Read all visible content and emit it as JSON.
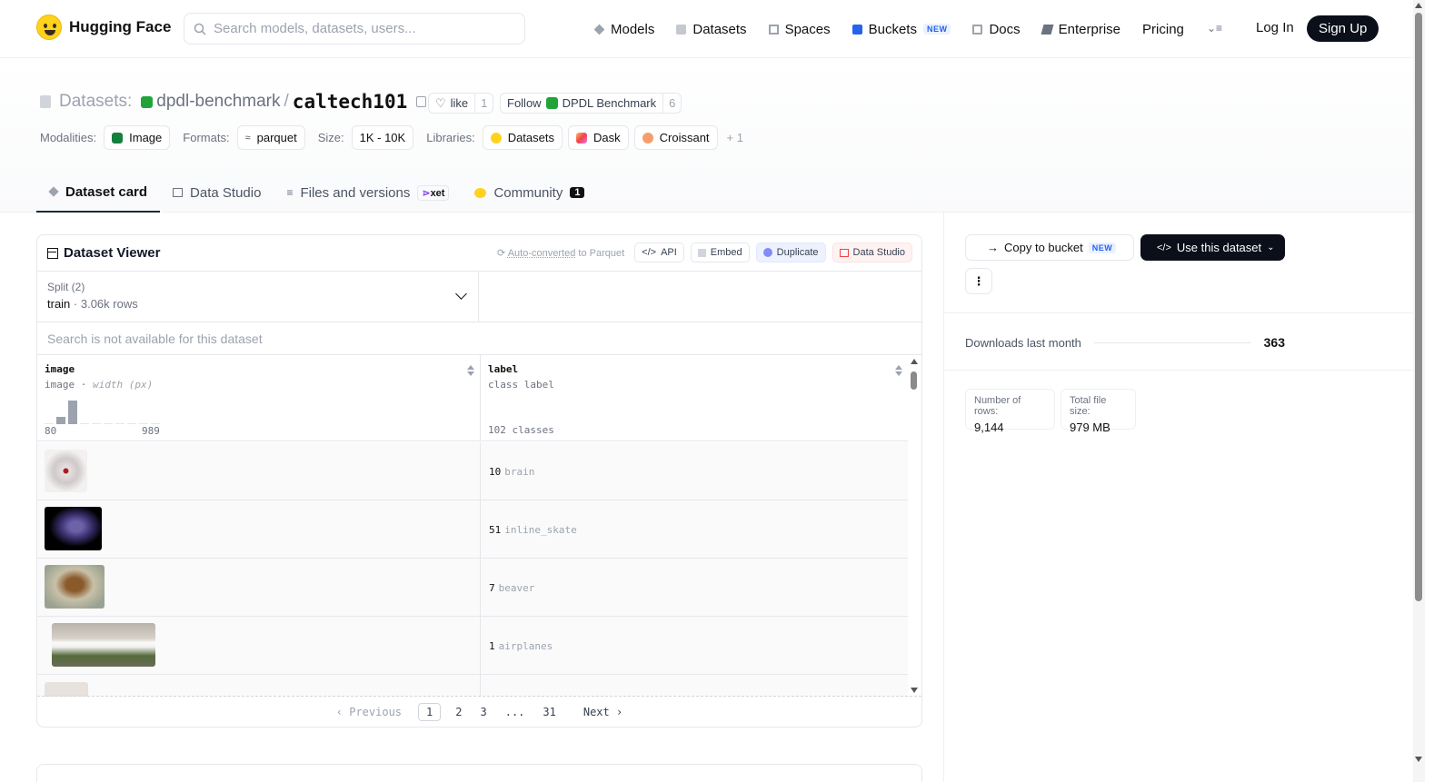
{
  "colors": {
    "brand_yellow": "#FFD21E",
    "dark": "#0b0f19",
    "org_green": "#22a33a",
    "new_blue": "#2563eb"
  },
  "nav": {
    "brand": "Hugging Face",
    "search_placeholder": "Search models, datasets, users...",
    "links": [
      {
        "label": "Models",
        "icon": "cube-icon"
      },
      {
        "label": "Datasets",
        "icon": "database-icon"
      },
      {
        "label": "Spaces",
        "icon": "grid-icon"
      },
      {
        "label": "Buckets",
        "icon": "bucket-icon",
        "badge": "NEW"
      },
      {
        "label": "Docs",
        "icon": "book-icon"
      },
      {
        "label": "Enterprise",
        "icon": "enterprise-icon"
      },
      {
        "label": "Pricing"
      }
    ],
    "login": "Log In",
    "signup": "Sign Up"
  },
  "header": {
    "section": "Datasets:",
    "org": "dpdl-benchmark",
    "slash": "/",
    "repo": "caltech101",
    "like_label": "like",
    "like_count": "1",
    "follow_label": "Follow",
    "follow_org": "DPDL Benchmark",
    "follow_count": "6",
    "tags": {
      "modalities_label": "Modalities:",
      "modality": "Image",
      "formats_label": "Formats:",
      "format": "parquet",
      "size_label": "Size:",
      "size": "1K - 10K",
      "libraries_label": "Libraries:",
      "libraries": [
        "Datasets",
        "Dask",
        "Croissant"
      ],
      "more": "+ 1"
    },
    "tabs": [
      {
        "label": "Dataset card",
        "active": true
      },
      {
        "label": "Data Studio"
      },
      {
        "label": "Files and versions",
        "badge": "xet"
      },
      {
        "label": "Community",
        "count": "1"
      }
    ]
  },
  "viewer": {
    "title": "Dataset Viewer",
    "auto_converted": "Auto-converted",
    "auto_to": "to Parquet",
    "api": "API",
    "embed": "Embed",
    "duplicate": "Duplicate",
    "data_studio": "Data Studio",
    "split_label": "Split (2)",
    "split_value": "train",
    "split_rows": "3.06k rows",
    "search_disabled": "Search is not available for this dataset",
    "columns": [
      {
        "name": "image",
        "type": "image",
        "type_detail": "width (px)",
        "hist_min": "80",
        "hist_max": "989",
        "histogram": [
          0.05,
          0.3,
          1.0,
          0.05,
          0.05,
          0.05,
          0.05,
          0.0,
          0.0,
          0.05
        ]
      },
      {
        "name": "label",
        "type": "class label",
        "classes": "102 classes"
      }
    ],
    "rows": [
      {
        "label_id": "10",
        "label_name": "brain"
      },
      {
        "label_id": "51",
        "label_name": "inline_skate"
      },
      {
        "label_id": "7",
        "label_name": "beaver"
      },
      {
        "label_id": "1",
        "label_name": "airplanes"
      }
    ],
    "pager": {
      "prev": "Previous",
      "pages": [
        "1",
        "2",
        "3",
        "...",
        "31"
      ],
      "current": "1",
      "next": "Next"
    }
  },
  "sidebar": {
    "copy_bucket": "Copy to bucket",
    "copy_badge": "NEW",
    "use_dataset": "Use this dataset",
    "downloads_label": "Downloads last month",
    "downloads_value": "363",
    "rows_label": "Number of rows:",
    "rows_value": "9,144",
    "size_label": "Total file size:",
    "size_value": "979 MB"
  }
}
